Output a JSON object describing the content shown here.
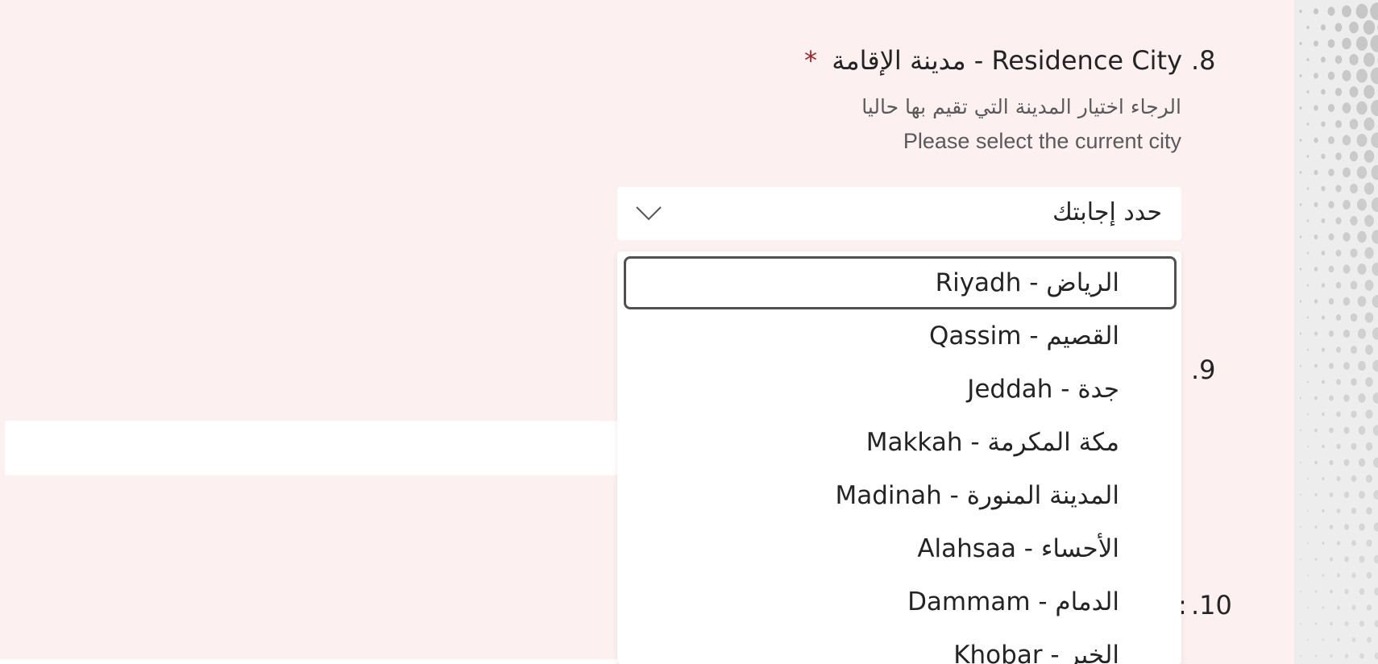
{
  "question8": {
    "number": ".8",
    "title": "Residence City - مدينة الإقامة",
    "required_mark": "*",
    "description_ar": "الرجاء اختيار المدينة التي تقيم بها حاليا",
    "description_en": "Please select the current city",
    "placeholder": "حدد إجابتك",
    "options": [
      "Riyadh - الرياض",
      "Qassim - القصيم",
      "Jeddah - جدة",
      "Makkah - مكة المكرمة",
      "Madinah - المدينة المنورة",
      "Alahsaa - الأحساء",
      "Dammam - الدمام",
      "Khobar - الخبر"
    ],
    "focused_option": "Riyadh - الرياض"
  },
  "question9": {
    "number": ".9"
  },
  "question10": {
    "number": ".10",
    "partial": ":"
  },
  "icons": {
    "dropdown_chevron": "chevron-down-icon"
  },
  "colors": {
    "form_background": "#fcf0f0",
    "required_star": "#a4262c",
    "text": "#242424",
    "description": "#5a5a5a",
    "focus_ring": "#505050"
  }
}
